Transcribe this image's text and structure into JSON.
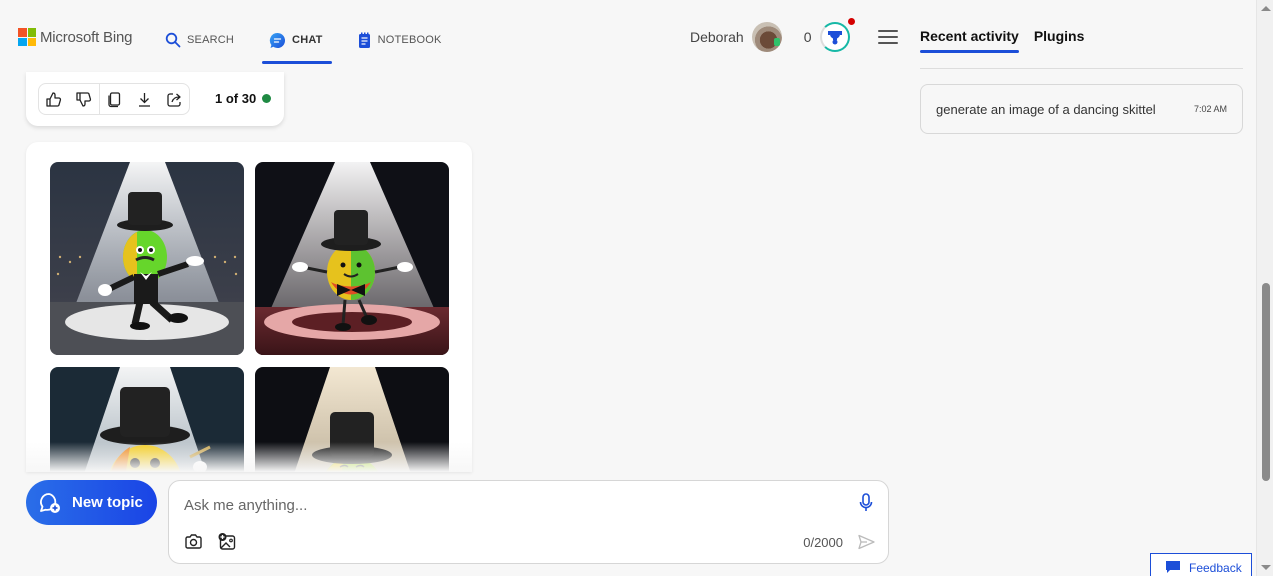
{
  "header": {
    "brand": "Microsoft Bing",
    "nav": [
      {
        "label": "SEARCH",
        "icon": "search-icon",
        "active": false
      },
      {
        "label": "CHAT",
        "icon": "chat-icon",
        "active": true
      },
      {
        "label": "NOTEBOOK",
        "icon": "notebook-icon",
        "active": false
      }
    ],
    "user_name": "Deborah",
    "reward_points": "0",
    "accent_color": "#1c4ed8"
  },
  "response_toolbar": {
    "actions": [
      "like",
      "dislike",
      "copy",
      "download",
      "share"
    ],
    "page_count": "1 of 30",
    "status_color": "#1f8a43"
  },
  "images": {
    "description": "Generated images of a dancing skittle wearing a top hat under a spotlight",
    "tiles": [
      {
        "alt": "Green and yellow skittle in top hat and tuxedo dancing on stage"
      },
      {
        "alt": "Multicolor skittle with top hat and bow tie dancing on red stage"
      },
      {
        "alt": "Yellow skittle with top hat holding a cane under spotlight"
      },
      {
        "alt": "Yellow-green skittle with top hat under warm spotlight"
      }
    ]
  },
  "composer": {
    "new_topic_label": "New topic",
    "placeholder": "Ask me anything...",
    "char_count": "0/2000"
  },
  "right_panel": {
    "tabs": [
      {
        "label": "Recent activity",
        "active": true
      },
      {
        "label": "Plugins",
        "active": false
      }
    ],
    "activity": [
      {
        "text": "generate an image of a dancing skittel",
        "time": "7:02 AM"
      }
    ]
  },
  "feedback_label": "Feedback"
}
